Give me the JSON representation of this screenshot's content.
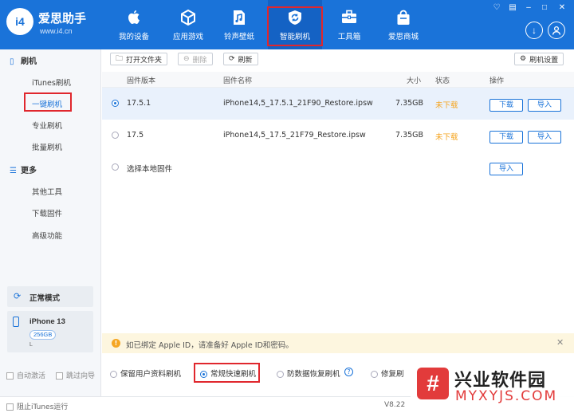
{
  "app": {
    "brand": "爱思助手",
    "site": "www.i4.cn",
    "logo_text": "i4",
    "version": "V8.22"
  },
  "nav": [
    {
      "label": "我的设备",
      "icon": "apple-icon"
    },
    {
      "label": "应用游戏",
      "icon": "cube-icon"
    },
    {
      "label": "铃声壁纸",
      "icon": "music-file-icon"
    },
    {
      "label": "智能刷机",
      "icon": "refresh-shield-icon",
      "active": true
    },
    {
      "label": "工具箱",
      "icon": "toolbox-icon"
    },
    {
      "label": "爱思商城",
      "icon": "shopping-bag-icon"
    }
  ],
  "sidebar": {
    "group1": "刷机",
    "items1": [
      "iTunes刷机",
      "一键刷机",
      "专业刷机",
      "批量刷机"
    ],
    "group2": "更多",
    "items2": [
      "其他工具",
      "下载固件",
      "高级功能"
    ],
    "mode": "正常模式",
    "device_name": "iPhone 13",
    "device_storage": "256GB",
    "device_extra": "L"
  },
  "toolbar": {
    "open_folder": "打开文件夹",
    "delete": "删除",
    "refresh": "刷新",
    "settings": "刷机设置"
  },
  "table": {
    "headers": {
      "version": "固件版本",
      "name": "固件名称",
      "size": "大小",
      "status": "状态",
      "action": "操作"
    },
    "rows": [
      {
        "version": "17.5.1",
        "name": "iPhone14,5_17.5.1_21F90_Restore.ipsw",
        "size": "7.35GB",
        "status": "未下载",
        "selected": true
      },
      {
        "version": "17.5",
        "name": "iPhone14,5_17.5_21F79_Restore.ipsw",
        "size": "7.35GB",
        "status": "未下载",
        "selected": false
      }
    ],
    "local": "选择本地固件",
    "download_label": "下载",
    "import_label": "导入"
  },
  "notice": "如已绑定 Apple ID，请准备好 Apple ID和密码。",
  "options": {
    "keep_data": "保留用户资料刷机",
    "quick": "常规快速刷机",
    "anti_recovery": "防数据恢复刷机",
    "repair": "修复刷"
  },
  "left_checks": {
    "auto_activate": "自动激活",
    "skip_guide": "跳过向导"
  },
  "footer": {
    "block_itunes": "阻止iTunes运行"
  },
  "watermark": {
    "glyph": "#",
    "name": "兴业软件园",
    "url": "MYXYJS.COM"
  },
  "colors": {
    "primary": "#1a73d9",
    "status_orange": "#f5a623",
    "highlight_red": "#e0272d"
  }
}
